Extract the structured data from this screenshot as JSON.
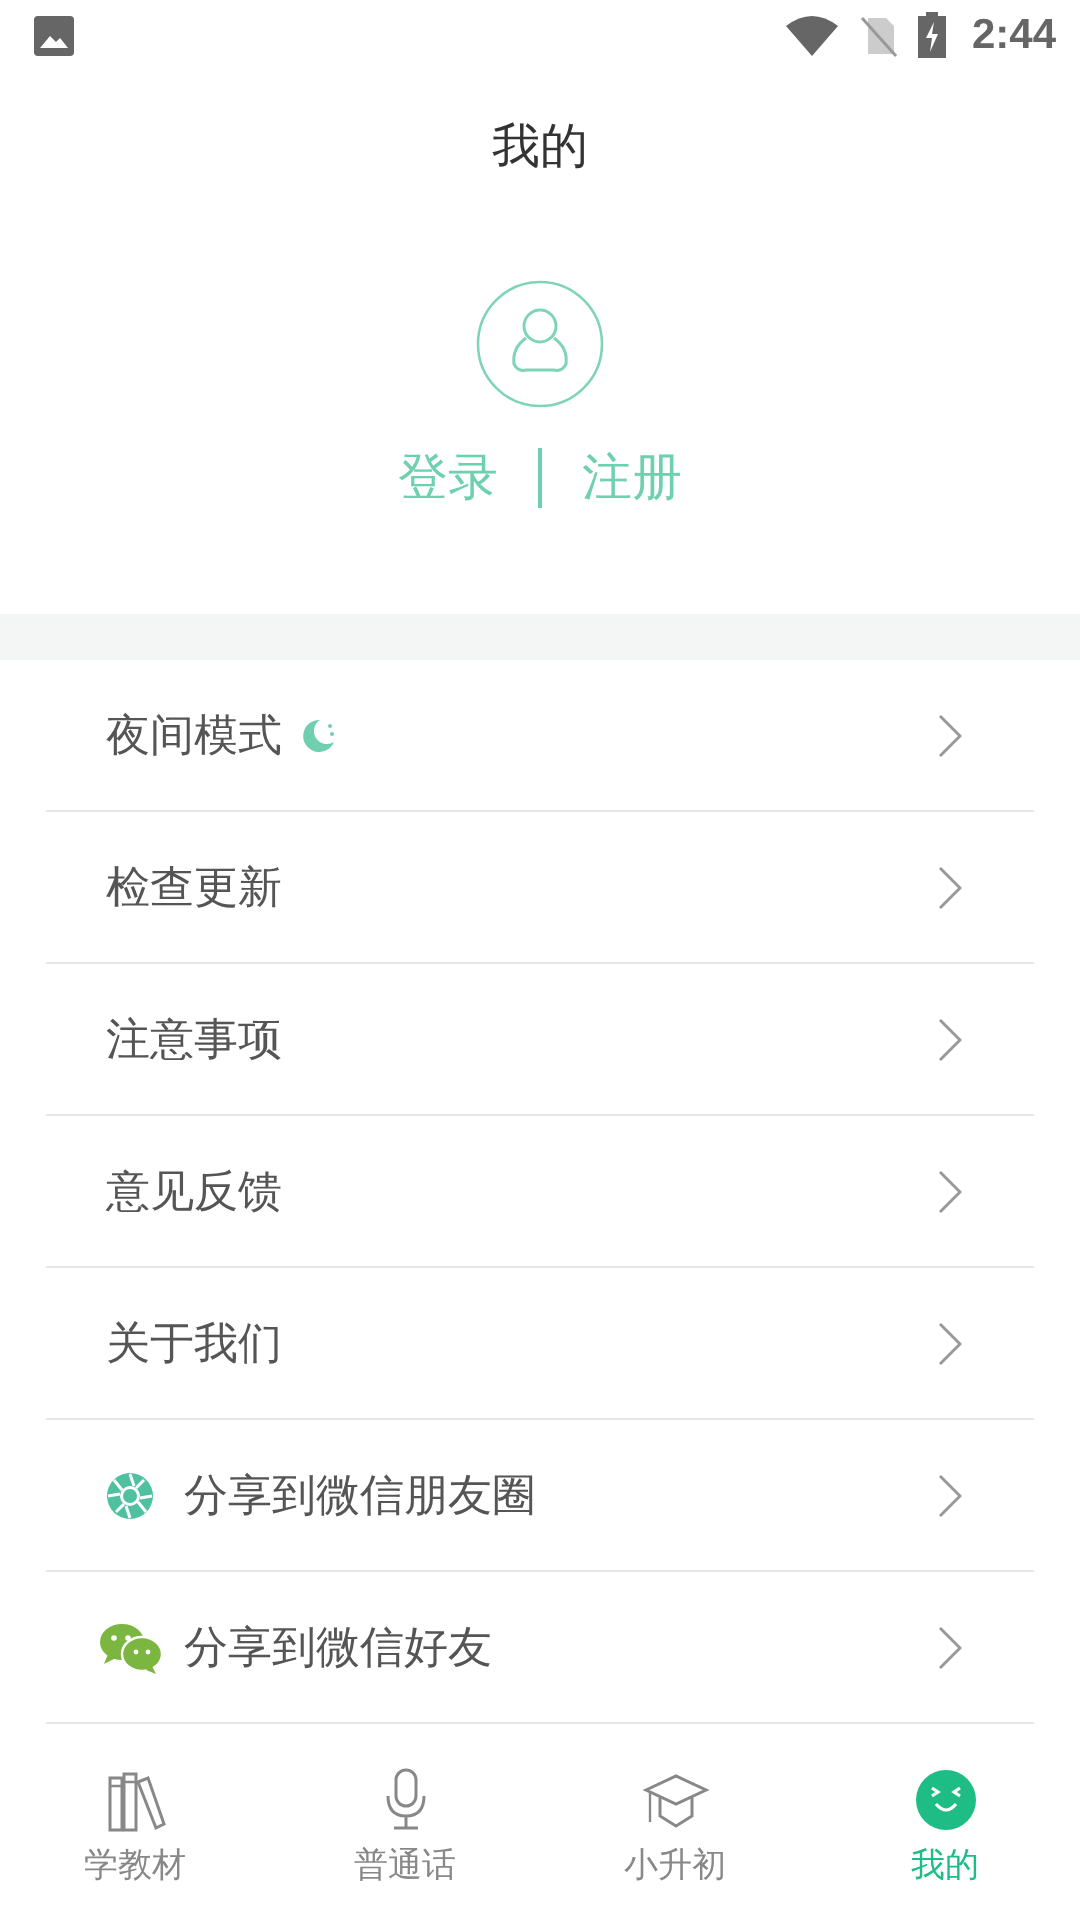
{
  "status_bar": {
    "time": "2:44"
  },
  "header": {
    "title": "我的"
  },
  "account": {
    "login": "登录",
    "register": "注册"
  },
  "menu": [
    {
      "label": "夜间模式",
      "kind": "night"
    },
    {
      "label": "检查更新",
      "kind": "plain"
    },
    {
      "label": "注意事项",
      "kind": "plain"
    },
    {
      "label": "意见反馈",
      "kind": "plain"
    },
    {
      "label": "关于我们",
      "kind": "plain"
    },
    {
      "label": "分享到微信朋友圈",
      "kind": "moments"
    },
    {
      "label": "分享到微信好友",
      "kind": "wechat"
    }
  ],
  "tabs": [
    {
      "label": "学教材",
      "kind": "books",
      "selected": false
    },
    {
      "label": "普通话",
      "kind": "mic",
      "selected": false
    },
    {
      "label": "小升初",
      "kind": "cap",
      "selected": false
    },
    {
      "label": "我的",
      "kind": "face",
      "selected": true
    }
  ]
}
